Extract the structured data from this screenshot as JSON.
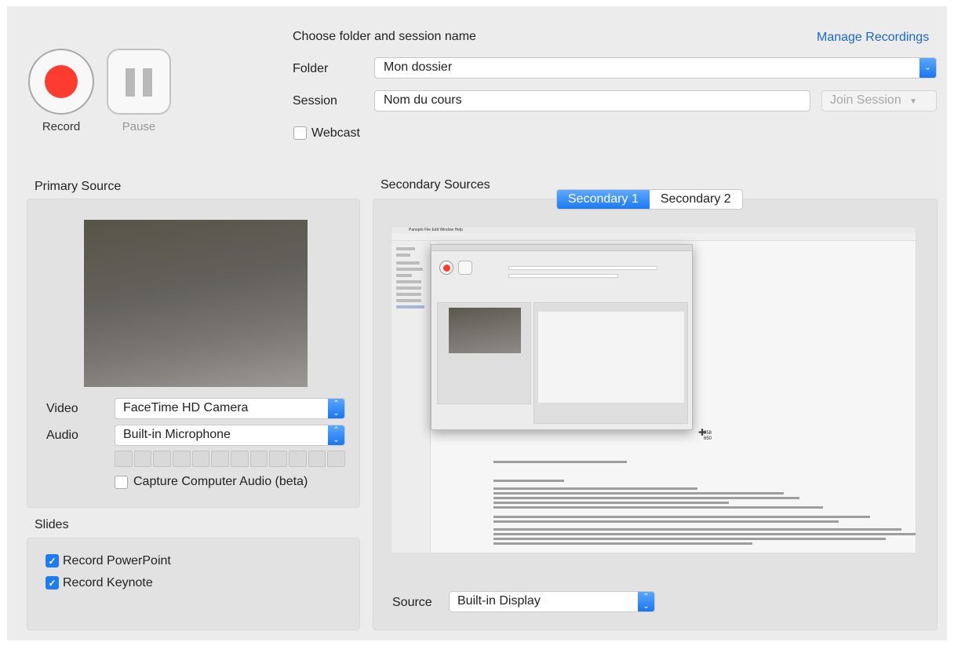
{
  "controls": {
    "record_label": "Record",
    "pause_label": "Pause"
  },
  "session": {
    "heading": "Choose folder and session name",
    "manage_link": "Manage Recordings",
    "folder_label": "Folder",
    "folder_value": "Mon dossier",
    "session_label": "Session",
    "session_value": "Nom du cours",
    "join_label": "Join Session",
    "webcast_label": "Webcast",
    "webcast_checked": false
  },
  "primary": {
    "title": "Primary Source",
    "video_label": "Video",
    "video_value": "FaceTime HD Camera",
    "audio_label": "Audio",
    "audio_value": "Built-in Microphone",
    "meter_level": 0,
    "capture_label": "Capture Computer Audio (beta)",
    "capture_checked": false
  },
  "slides": {
    "title": "Slides",
    "items": [
      {
        "label": "Record PowerPoint",
        "checked": true
      },
      {
        "label": "Record Keynote",
        "checked": true
      }
    ]
  },
  "secondary": {
    "title": "Secondary Sources",
    "tabs": [
      {
        "label": "Secondary 1",
        "active": true
      },
      {
        "label": "Secondary 2",
        "active": false
      }
    ],
    "source_label": "Source",
    "source_value": "Built-in Display",
    "preview": {
      "menubar_text": "Panopto  File  Edit  Window  Help",
      "coords": [
        "958",
        "650"
      ]
    }
  },
  "colors": {
    "accent": "#1e7bf2",
    "record": "#fd3b2f",
    "link": "#1a69cc"
  }
}
